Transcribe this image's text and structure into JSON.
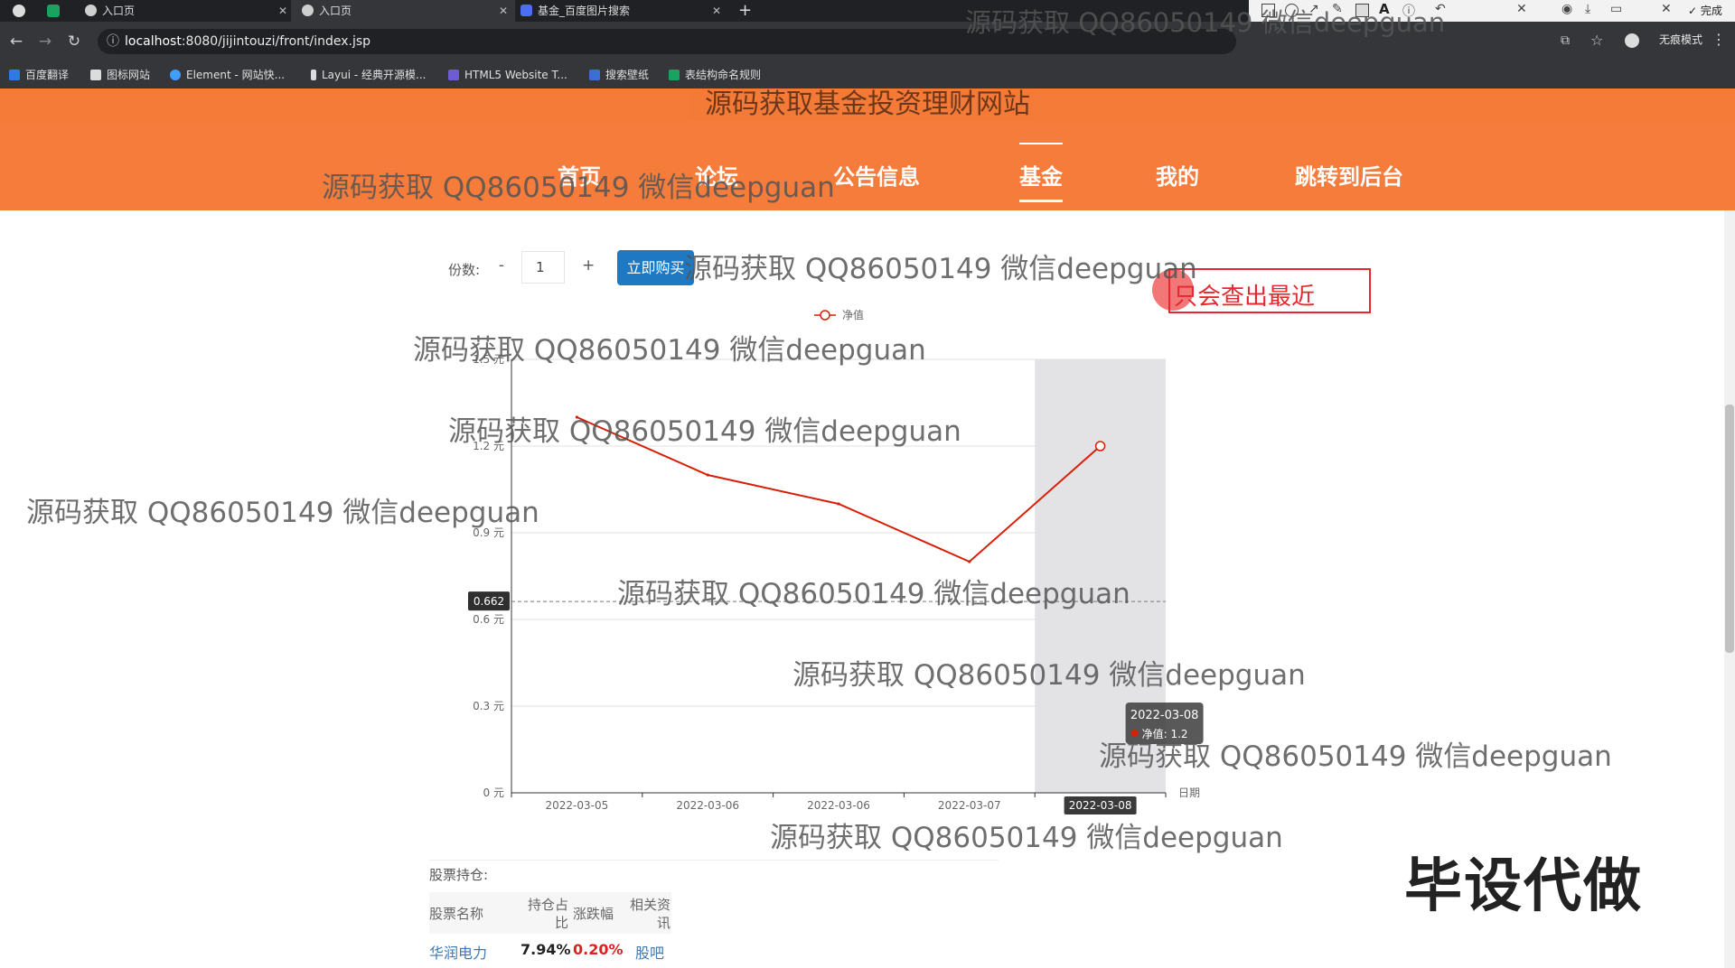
{
  "browser": {
    "tabs": [
      {
        "label": "入口页",
        "active": false
      },
      {
        "label": "入口页",
        "active": true
      },
      {
        "label": "基金_百度图片搜索",
        "active": false
      }
    ],
    "url_host": "localhost",
    "url_path": ":8080/jijintouzi/front/index.jsp",
    "bookmarks": [
      "百度翻译",
      "图标网站",
      "Element - 网站快...",
      "Layui - 经典开源模...",
      "HTML5 Website T...",
      "搜索壁纸",
      "表结构命名规则"
    ],
    "incognito_label": "无痕模式",
    "annot_font_size": "20",
    "annot_done": "完成"
  },
  "site": {
    "title": "源码获取基金投资理财网站",
    "nav": [
      {
        "label": "首页",
        "active": false
      },
      {
        "label": "论坛",
        "active": false
      },
      {
        "label": "公告信息",
        "active": false
      },
      {
        "label": "基金",
        "active": true
      },
      {
        "label": "我的",
        "active": false
      },
      {
        "label": "跳转到后台",
        "active": false
      }
    ]
  },
  "purchase": {
    "qty_label": "份数:",
    "minus": "-",
    "plus": "+",
    "qty_value": "1",
    "buy_label": "立即购买"
  },
  "annotation_text": "只会查出最近",
  "chart_data": {
    "type": "line",
    "legend": "净值",
    "categories": [
      "2022-03-05",
      "2022-03-06",
      "2022-03-06",
      "2022-03-07",
      "2022-03-08"
    ],
    "series": [
      {
        "name": "净值",
        "values": [
          1.3,
          1.1,
          1.0,
          0.8,
          1.2
        ],
        "color": "#d81e06"
      }
    ],
    "yticks": [
      "0 元",
      "0.3 元",
      "0.6 元",
      "0.9 元",
      "1.2 元",
      "1.5 元"
    ],
    "ylim": [
      0,
      1.5
    ],
    "xlabel": "日期",
    "grid": true,
    "crosshair_y": 0.662,
    "crosshair_label": "0.662",
    "highlight_index": 4,
    "tooltip": {
      "date": "2022-03-08",
      "text": "净值: 1.2"
    }
  },
  "holdings": {
    "title": "股票持仓:",
    "headers": [
      "股票名称",
      "持仓占比",
      "涨跌幅",
      "相关资讯"
    ],
    "rows": [
      {
        "name": "华润电力",
        "ratio": "7.94%",
        "change": "0.20%",
        "link": "股吧"
      }
    ]
  },
  "watermark": "源码获取 QQ86050149 微信deepguan",
  "overlay_text": "毕设代做"
}
